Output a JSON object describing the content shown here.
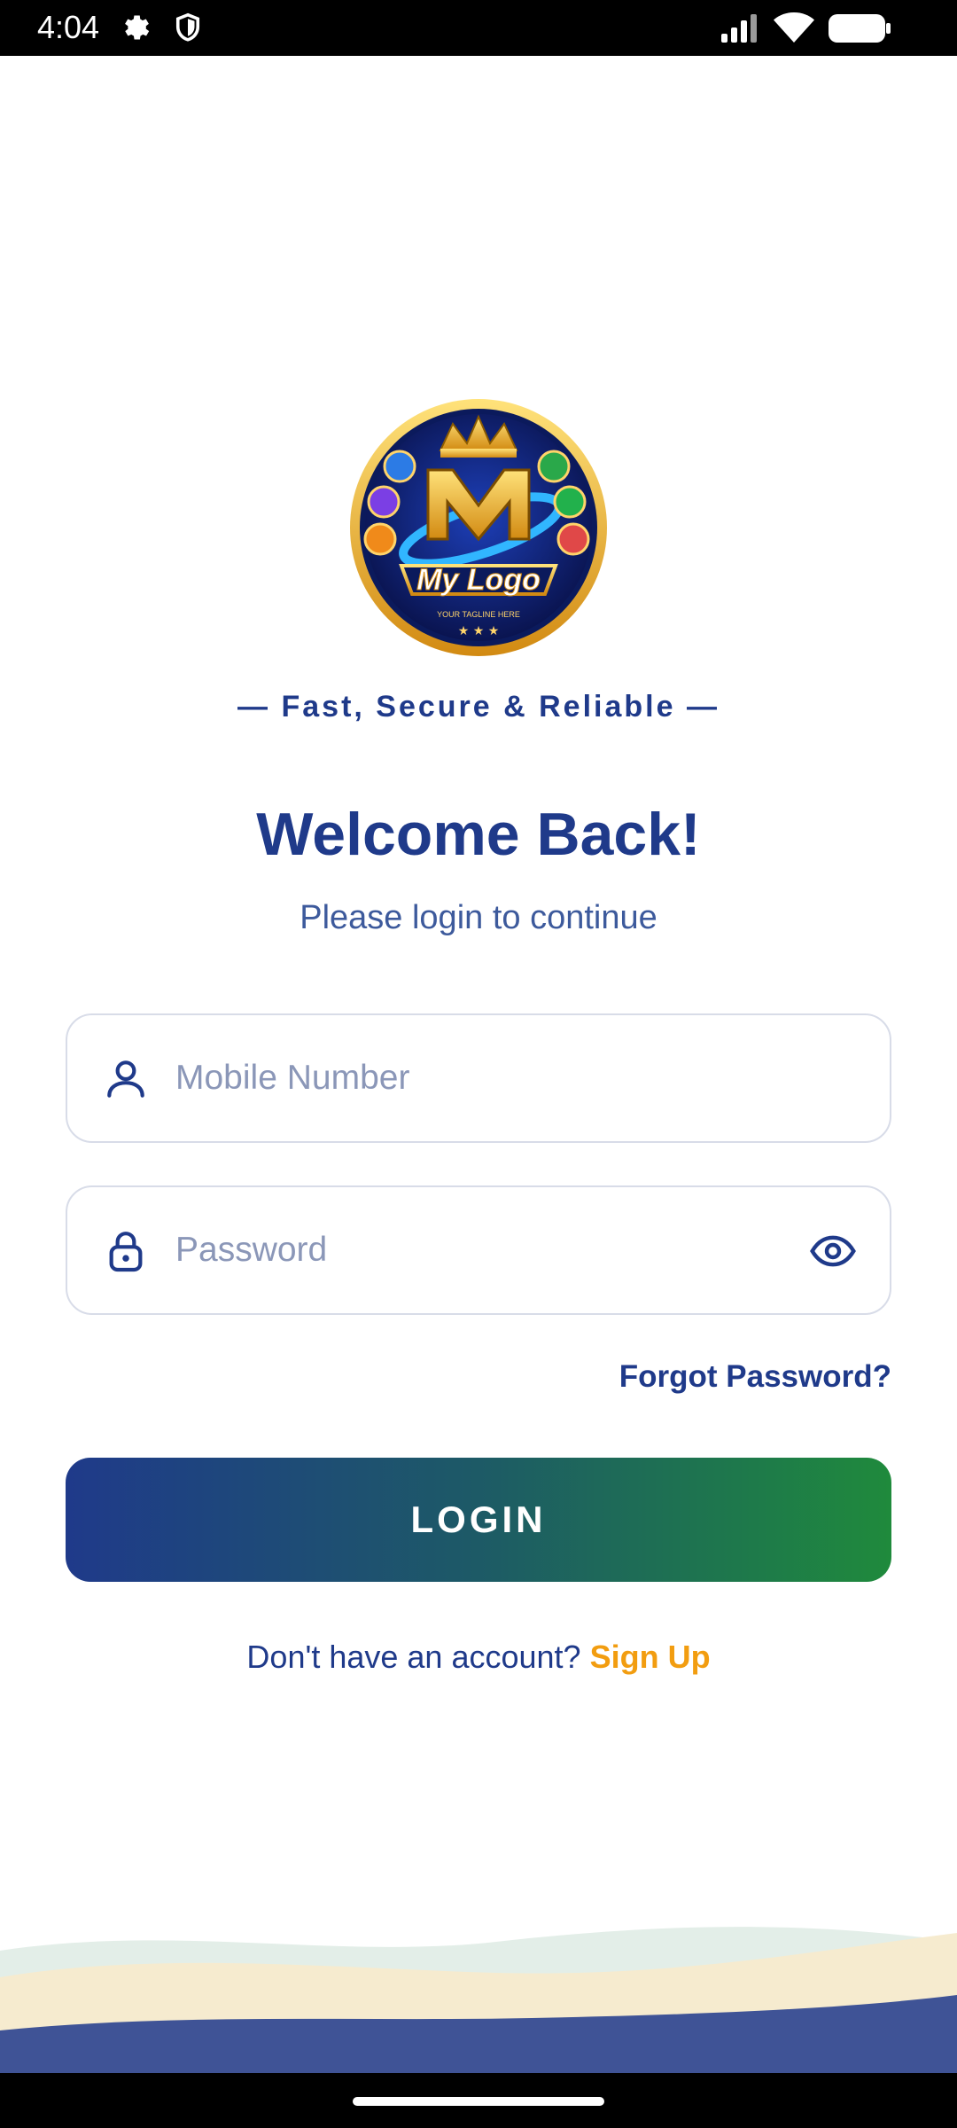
{
  "status_bar": {
    "time": "4:04",
    "icons": [
      "settings-icon",
      "shield-icon",
      "signal-icon",
      "wifi-icon",
      "battery-icon"
    ]
  },
  "logo": {
    "brand_text": "My Logo",
    "tagline_small": "YOUR TAGLINE HERE"
  },
  "tagline": "— Fast, Secure & Reliable —",
  "welcome": {
    "title": "Welcome Back!",
    "subtitle": "Please login to continue"
  },
  "form": {
    "mobile_placeholder": "Mobile Number",
    "password_placeholder": "Password",
    "forgot_label": "Forgot Password?",
    "login_label": "LOGIN"
  },
  "signup": {
    "prompt": "Don't have an account?",
    "link_label": "Sign Up"
  },
  "colors": {
    "primary": "#1f3a8a",
    "accent_orange": "#f29d10",
    "gradient_start": "#1f3a8a",
    "gradient_end": "#1f8a3c"
  }
}
